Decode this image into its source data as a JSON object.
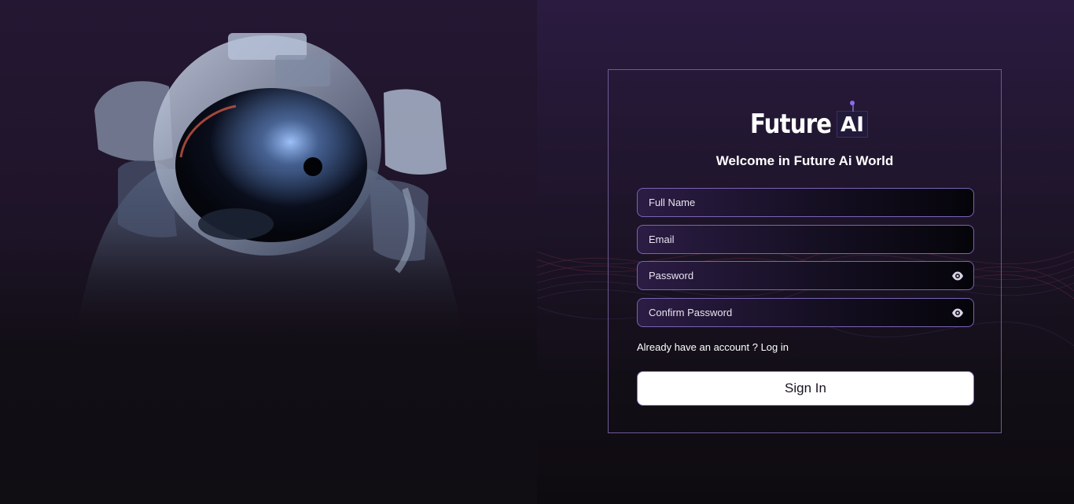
{
  "brand": {
    "logo_word": "Future",
    "logo_ai": "AI"
  },
  "form": {
    "welcome": "Welcome in Future Ai World",
    "full_name_placeholder": "Full Name",
    "email_placeholder": "Email",
    "password_placeholder": "Password",
    "confirm_password_placeholder": "Confirm Password",
    "have_account_text": "Already have an account ?",
    "login_link": "Log in",
    "sign_in_label": "Sign In"
  },
  "icons": {
    "password_toggle": "eye-icon",
    "confirm_password_toggle": "eye-icon"
  },
  "colors": {
    "accent": "#7a63b6",
    "card_border": "#6e5a96",
    "background_top": "#2a1b40",
    "background_bottom": "#0e0b10"
  }
}
